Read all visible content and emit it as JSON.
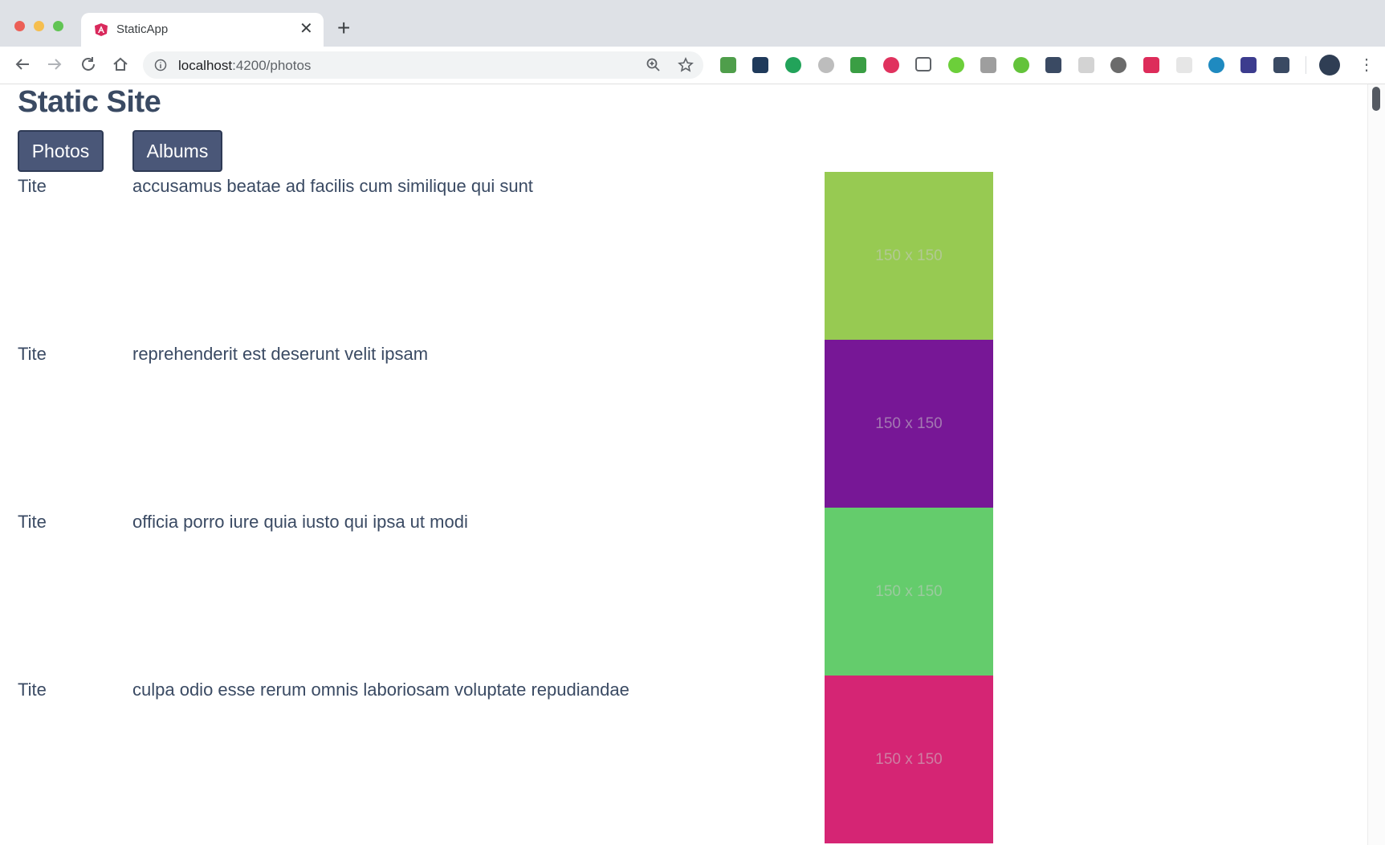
{
  "browser": {
    "tab_title": "StaticApp",
    "url_host": "localhost",
    "url_path": ":4200/photos",
    "traffic_lights": [
      "#ec5f57",
      "#f5be4f",
      "#61c454"
    ],
    "extension_colors": [
      "#4f9e4b",
      "#1f3a5b",
      "#22a35a",
      "#bdbdbd",
      "#3a9e44",
      "#e0325e",
      "#5f6368",
      "#6ccf3a",
      "#9e9e9e",
      "#63c33a",
      "#3a4a63",
      "#d3d3d3",
      "#6b6b6b",
      "#dd2c5a",
      "#e6e6e6",
      "#1f8ac0",
      "#3c3c8e",
      "#3a4a63"
    ]
  },
  "page": {
    "title": "Static Site",
    "nav": {
      "photos": "Photos",
      "albums": "Albums"
    },
    "rows": [
      {
        "label": "Tite",
        "title": "accusamus beatae ad facilis cum similique qui sunt",
        "thumb_text": "150 x 150",
        "color": "#97ca52"
      },
      {
        "label": "Tite",
        "title": "reprehenderit est deserunt velit ipsam",
        "thumb_text": "150 x 150",
        "color": "#771796"
      },
      {
        "label": "Tite",
        "title": "officia porro iure quia iusto qui ipsa ut modi",
        "thumb_text": "150 x 150",
        "color": "#64cc6c"
      },
      {
        "label": "Tite",
        "title": "culpa odio esse rerum omnis laboriosam voluptate repudiandae",
        "thumb_text": "150 x 150",
        "color": "#d52574"
      }
    ]
  }
}
